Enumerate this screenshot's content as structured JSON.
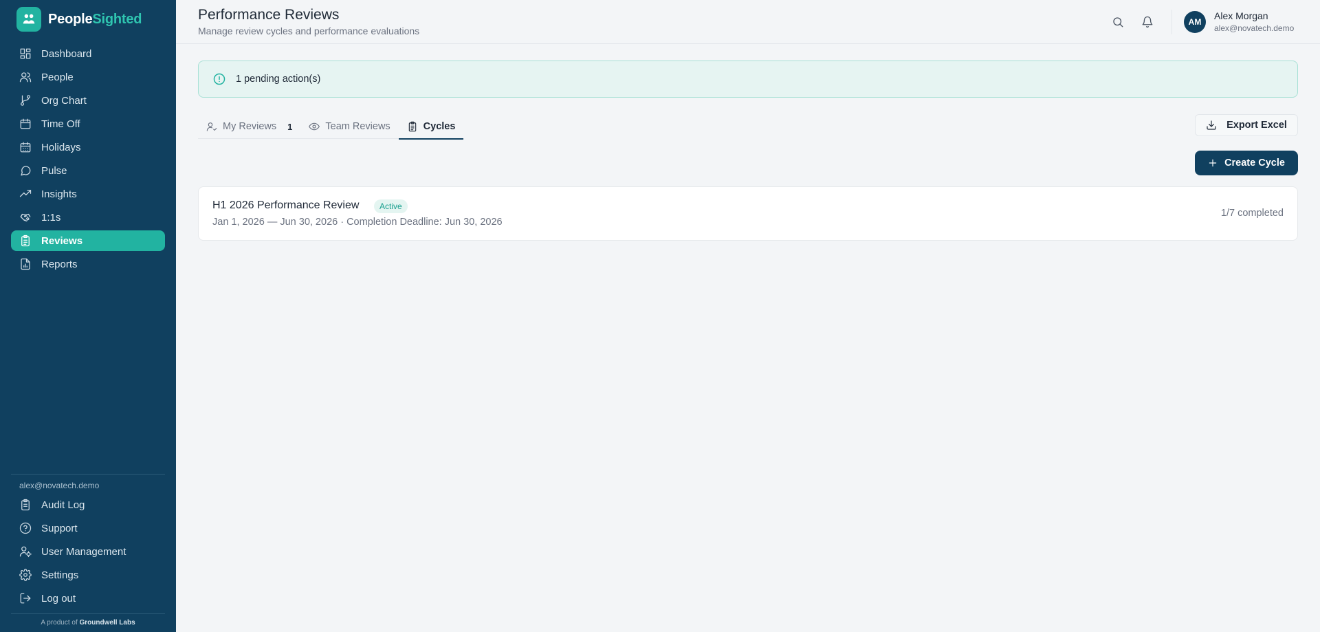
{
  "brand": {
    "name_part1": "People",
    "name_part2": "Sighted"
  },
  "sidebar": {
    "items": [
      {
        "label": "Dashboard",
        "icon": "dashboard-icon"
      },
      {
        "label": "People",
        "icon": "people-icon"
      },
      {
        "label": "Org Chart",
        "icon": "org-chart-icon"
      },
      {
        "label": "Time Off",
        "icon": "calendar-icon"
      },
      {
        "label": "Holidays",
        "icon": "calendar-grid-icon"
      },
      {
        "label": "Pulse",
        "icon": "chat-bubble-icon"
      },
      {
        "label": "Insights",
        "icon": "trend-up-icon"
      },
      {
        "label": "1:1s",
        "icon": "handshake-icon"
      },
      {
        "label": "Reviews",
        "icon": "clipboard-icon",
        "active": true
      },
      {
        "label": "Reports",
        "icon": "report-icon"
      }
    ],
    "user_email": "alex@novatech.demo",
    "bottom_items": [
      {
        "label": "Audit Log",
        "icon": "clipboard-list-icon"
      },
      {
        "label": "Support",
        "icon": "help-circle-icon"
      },
      {
        "label": "User Management",
        "icon": "user-cog-icon"
      },
      {
        "label": "Settings",
        "icon": "gear-icon"
      },
      {
        "label": "Log out",
        "icon": "logout-icon"
      }
    ],
    "footer_prefix": "A product of",
    "footer_company": "Groundwell Labs"
  },
  "header": {
    "title": "Performance Reviews",
    "subtitle": "Manage review cycles and performance evaluations",
    "user": {
      "initials": "AM",
      "name": "Alex Morgan",
      "email": "alex@novatech.demo"
    }
  },
  "alert": {
    "text": "1 pending action(s)"
  },
  "tabs": [
    {
      "label": "My Reviews",
      "count": "1",
      "icon": "user-check-icon"
    },
    {
      "label": "Team Reviews",
      "icon": "eye-icon"
    },
    {
      "label": "Cycles",
      "icon": "clipboard-icon",
      "active": true
    }
  ],
  "actions": {
    "export_label": "Export Excel",
    "create_label": "Create Cycle"
  },
  "cycles": [
    {
      "title": "H1 2026 Performance Review",
      "status": "Active",
      "meta": "Jan 1, 2026 — Jun 30, 2026 · Completion Deadline: Jun 30, 2026",
      "progress": "1/7 completed"
    }
  ],
  "colors": {
    "sidebar_bg": "#10405f",
    "accent": "#22b3a1",
    "primary_button": "#10405f"
  }
}
